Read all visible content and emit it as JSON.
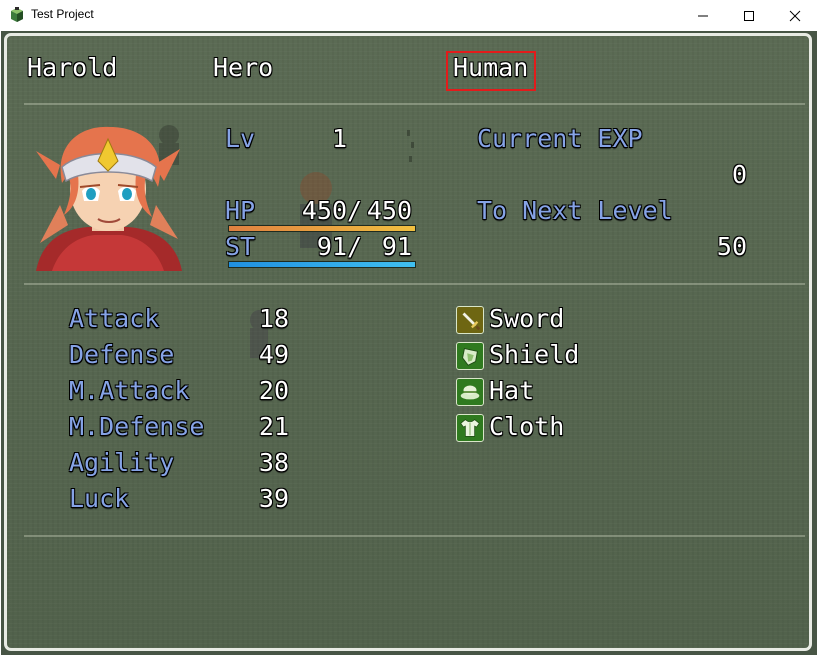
{
  "window": {
    "title": "Test Project",
    "controls": {
      "minimize": "minimize-icon",
      "maximize": "maximize-icon",
      "close": "close-icon"
    }
  },
  "header": {
    "name": "Harold",
    "class": "Hero",
    "race": "Human"
  },
  "status": {
    "level_label": "Lv",
    "level": "1",
    "hp_label": "HP",
    "hp_current": "450",
    "hp_max": "450",
    "st_label": "ST",
    "st_current": "91",
    "st_max": "91",
    "slash": "/",
    "hp_fill": 1.0,
    "st_fill": 1.0
  },
  "exp": {
    "current_label": "Current EXP",
    "current_value": "0",
    "next_label": "To Next Level",
    "next_value": "50"
  },
  "params": [
    {
      "label": "Attack",
      "value": "18"
    },
    {
      "label": "Defense",
      "value": "49"
    },
    {
      "label": "M.Attack",
      "value": "20"
    },
    {
      "label": "M.Defense",
      "value": "21"
    },
    {
      "label": "Agility",
      "value": "38"
    },
    {
      "label": "Luck",
      "value": "39"
    }
  ],
  "equipment": [
    {
      "name": "Sword",
      "icon": "sword-icon"
    },
    {
      "name": "Shield",
      "icon": "shield-icon"
    },
    {
      "name": "Hat",
      "icon": "hat-icon"
    },
    {
      "name": "Cloth",
      "icon": "cloth-icon"
    }
  ],
  "colors": {
    "system_text": "#86a3e6",
    "normal_text": "#ffffff",
    "hp_gauge": "#f0a040",
    "st_gauge": "#40b0f0",
    "highlight": "#e31b1b"
  }
}
